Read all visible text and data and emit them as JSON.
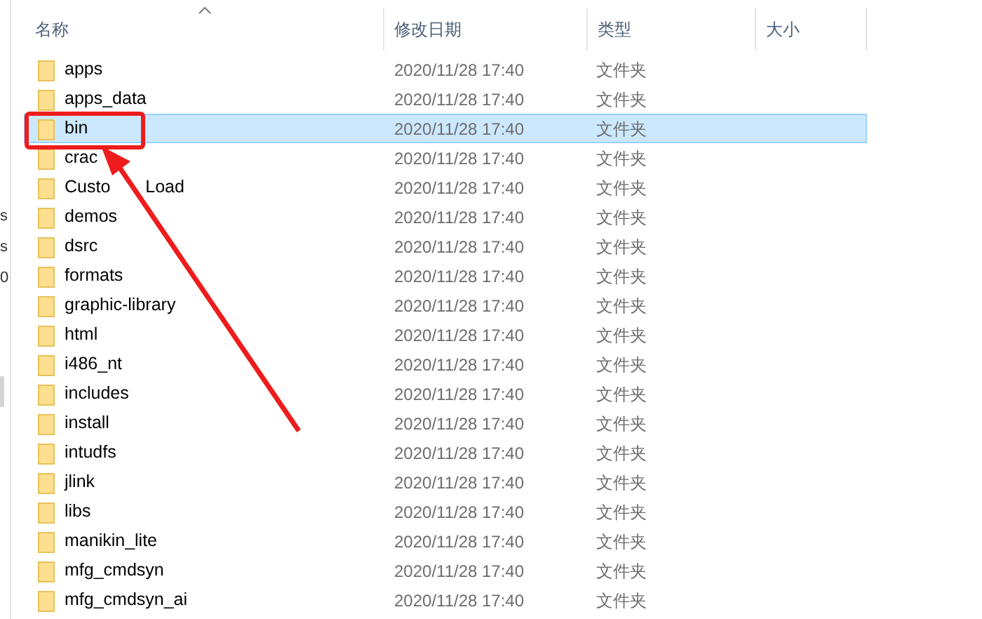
{
  "nav_pane": {
    "items": [
      "s",
      "s",
      "0"
    ]
  },
  "columns": [
    {
      "label": "名称",
      "sorted": true
    },
    {
      "label": "修改日期",
      "sorted": false
    },
    {
      "label": "类型",
      "sorted": false
    },
    {
      "label": "大小",
      "sorted": false
    }
  ],
  "rows": [
    {
      "name": "apps",
      "modified": "2020/11/28 17:40",
      "type": "文件夹",
      "selected": false
    },
    {
      "name": "apps_data",
      "modified": "2020/11/28 17:40",
      "type": "文件夹",
      "selected": false
    },
    {
      "name": "bin",
      "modified": "2020/11/28 17:40",
      "type": "文件夹",
      "selected": true
    },
    {
      "name": "crac",
      "modified": "2020/11/28 17:40",
      "type": "文件夹",
      "selected": false
    },
    {
      "name_parts": [
        "Custo",
        "Load"
      ],
      "modified": "2020/11/28 17:40",
      "type": "文件夹",
      "selected": false
    },
    {
      "name": "demos",
      "modified": "2020/11/28 17:40",
      "type": "文件夹",
      "selected": false
    },
    {
      "name": "dsrc",
      "modified": "2020/11/28 17:40",
      "type": "文件夹",
      "selected": false
    },
    {
      "name": "formats",
      "modified": "2020/11/28 17:40",
      "type": "文件夹",
      "selected": false
    },
    {
      "name": "graphic-library",
      "modified": "2020/11/28 17:40",
      "type": "文件夹",
      "selected": false
    },
    {
      "name": "html",
      "modified": "2020/11/28 17:40",
      "type": "文件夹",
      "selected": false
    },
    {
      "name": "i486_nt",
      "modified": "2020/11/28 17:40",
      "type": "文件夹",
      "selected": false
    },
    {
      "name": "includes",
      "modified": "2020/11/28 17:40",
      "type": "文件夹",
      "selected": false
    },
    {
      "name": "install",
      "modified": "2020/11/28 17:40",
      "type": "文件夹",
      "selected": false
    },
    {
      "name": "intudfs",
      "modified": "2020/11/28 17:40",
      "type": "文件夹",
      "selected": false
    },
    {
      "name": "jlink",
      "modified": "2020/11/28 17:40",
      "type": "文件夹",
      "selected": false
    },
    {
      "name": "libs",
      "modified": "2020/11/28 17:40",
      "type": "文件夹",
      "selected": false
    },
    {
      "name": "manikin_lite",
      "modified": "2020/11/28 17:40",
      "type": "文件夹",
      "selected": false
    },
    {
      "name": "mfg_cmdsyn",
      "modified": "2020/11/28 17:40",
      "type": "文件夹",
      "selected": false
    },
    {
      "name": "mfg_cmdsyn_ai",
      "modified": "2020/11/28 17:40",
      "type": "文件夹",
      "selected": false
    }
  ]
}
